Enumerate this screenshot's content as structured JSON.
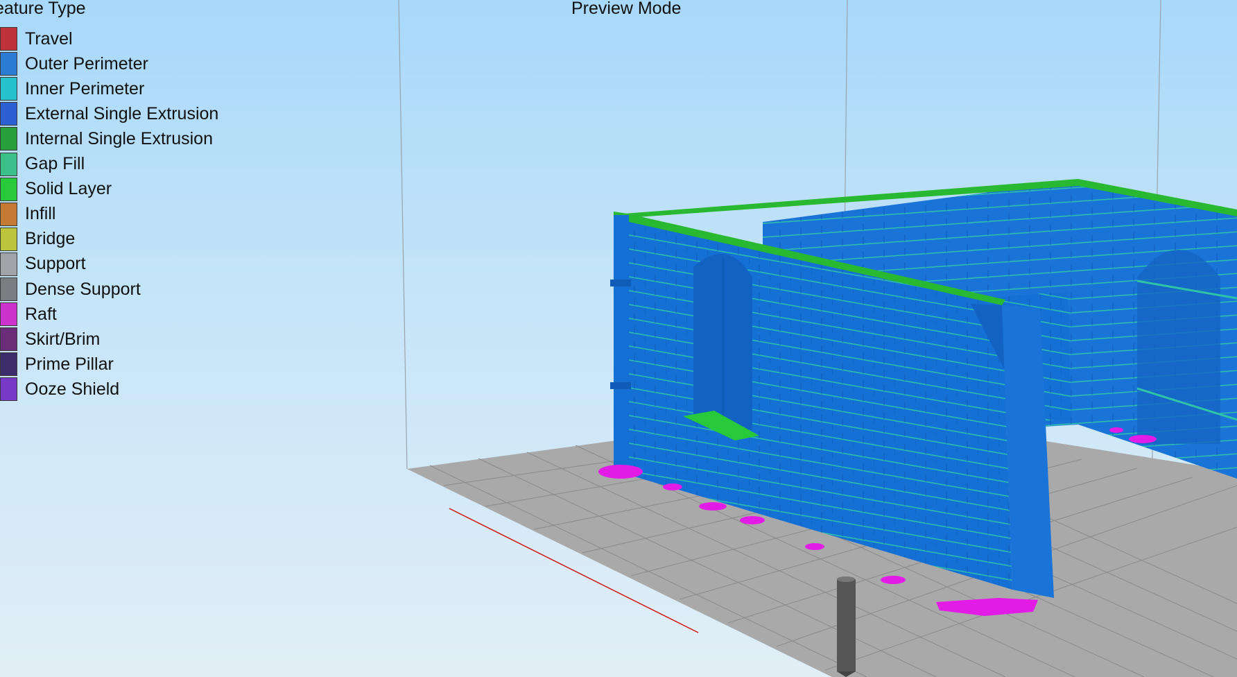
{
  "viewport": {
    "title": "Preview Mode",
    "background_top": "#a8d8fa",
    "background_bottom": "#e2eef6"
  },
  "legend": {
    "title": "eature Type",
    "items": [
      {
        "label": "Travel",
        "color": "#c0323a"
      },
      {
        "label": "Outer Perimeter",
        "color": "#2c7bd2"
      },
      {
        "label": "Inner Perimeter",
        "color": "#25c2cc"
      },
      {
        "label": "External Single Extrusion",
        "color": "#2c5fd2"
      },
      {
        "label": "Internal Single Extrusion",
        "color": "#27a03c"
      },
      {
        "label": "Gap Fill",
        "color": "#3cc089"
      },
      {
        "label": "Solid Layer",
        "color": "#29c93c"
      },
      {
        "label": "Infill",
        "color": "#c57a33"
      },
      {
        "label": "Bridge",
        "color": "#bcc43a"
      },
      {
        "label": "Support",
        "color": "#a0a4a8"
      },
      {
        "label": "Dense Support",
        "color": "#7a7e82"
      },
      {
        "label": "Raft",
        "color": "#cc33cc"
      },
      {
        "label": "Skirt/Brim",
        "color": "#6b2c78"
      },
      {
        "label": "Prime Pillar",
        "color": "#3e2d6b"
      },
      {
        "label": "Ooze Shield",
        "color": "#7838c8"
      }
    ]
  },
  "scene_colors": {
    "bed": "#a9a9a9",
    "grid": "#8a8a8a",
    "wall": "#1570d6",
    "wall_top": "#28b832",
    "raft": "#e21be6",
    "nozzle": "#555555",
    "axis": "#d01010"
  }
}
